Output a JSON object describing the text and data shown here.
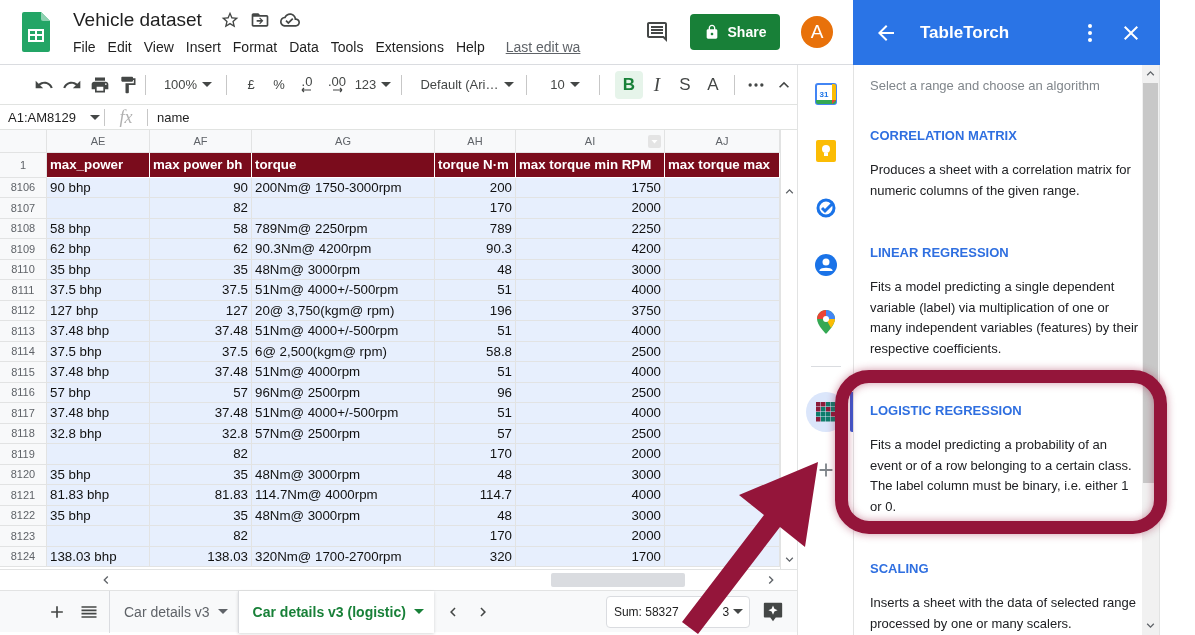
{
  "document": {
    "title": "Vehicle dataset",
    "last_edit": "Last edit wa"
  },
  "menu": [
    "File",
    "Edit",
    "View",
    "Insert",
    "Format",
    "Data",
    "Tools",
    "Extensions",
    "Help"
  ],
  "share_button": "Share",
  "avatar": "A",
  "toolbar": {
    "zoom": "100%",
    "currency": "£",
    "percent": "%",
    "decrease_decimals": ".0",
    "increase_decimals": ".00",
    "number_format": "123",
    "font": "Default (Ari…",
    "font_size": "10",
    "bold": {
      "label": "B",
      "on": true
    },
    "italic": "I",
    "strikethrough": "S",
    "text_color": "A"
  },
  "formula_bar": {
    "name_box": "A1:AM8129",
    "fx": "fx",
    "content": "name"
  },
  "sheet": {
    "selected_range": true,
    "columns": [
      {
        "letter": "AE",
        "kind": "text",
        "filter": false
      },
      {
        "letter": "AF",
        "kind": "number",
        "filter": false
      },
      {
        "letter": "AG",
        "kind": "text",
        "filter": false
      },
      {
        "letter": "AH",
        "kind": "number",
        "filter": false
      },
      {
        "letter": "AI",
        "kind": "number",
        "filter": true
      },
      {
        "letter": "AJ",
        "kind": "number",
        "filter": false
      }
    ],
    "header_row": {
      "number": "1",
      "cells": [
        "max_power",
        "max power bh",
        "torque",
        "torque N·m",
        "max torque min RPM",
        "max torque max"
      ]
    },
    "rows": [
      {
        "number": "8106",
        "cells": [
          "90 bhp",
          "90",
          "200Nm@ 1750-3000rpm",
          "200",
          "1750",
          null
        ]
      },
      {
        "number": "8107",
        "cells": [
          null,
          "82",
          null,
          "170",
          "2000",
          null
        ]
      },
      {
        "number": "8108",
        "cells": [
          "58 bhp",
          "58",
          "789Nm@ 2250rpm",
          "789",
          "2250",
          null
        ]
      },
      {
        "number": "8109",
        "cells": [
          "62 bhp",
          "62",
          "90.3Nm@ 4200rpm",
          "90.3",
          "4200",
          null
        ]
      },
      {
        "number": "8110",
        "cells": [
          "35 bhp",
          "35",
          "48Nm@ 3000rpm",
          "48",
          "3000",
          null
        ]
      },
      {
        "number": "8111",
        "cells": [
          "37.5 bhp",
          "37.5",
          "51Nm@ 4000+/-500rpm",
          "51",
          "4000",
          null
        ]
      },
      {
        "number": "8112",
        "cells": [
          "127 bhp",
          "127",
          "20@ 3,750(kgm@ rpm)",
          "196",
          "3750",
          null
        ]
      },
      {
        "number": "8113",
        "cells": [
          "37.48 bhp",
          "37.48",
          "51Nm@ 4000+/-500rpm",
          "51",
          "4000",
          null
        ]
      },
      {
        "number": "8114",
        "cells": [
          "37.5 bhp",
          "37.5",
          "6@ 2,500(kgm@ rpm)",
          "58.8",
          "2500",
          null
        ]
      },
      {
        "number": "8115",
        "cells": [
          "37.48 bhp",
          "37.48",
          "51Nm@ 4000rpm",
          "51",
          "4000",
          null
        ]
      },
      {
        "number": "8116",
        "cells": [
          "57 bhp",
          "57",
          "96Nm@ 2500rpm",
          "96",
          "2500",
          null
        ]
      },
      {
        "number": "8117",
        "cells": [
          "37.48 bhp",
          "37.48",
          "51Nm@ 4000+/-500rpm",
          "51",
          "4000",
          null
        ]
      },
      {
        "number": "8118",
        "cells": [
          "32.8 bhp",
          "32.8",
          "57Nm@ 2500rpm",
          "57",
          "2500",
          null
        ]
      },
      {
        "number": "8119",
        "cells": [
          null,
          "82",
          null,
          "170",
          "2000",
          null
        ]
      },
      {
        "number": "8120",
        "cells": [
          "35 bhp",
          "35",
          "48Nm@ 3000rpm",
          "48",
          "3000",
          null
        ]
      },
      {
        "number": "8121",
        "cells": [
          "81.83 bhp",
          "81.83",
          "114.7Nm@ 4000rpm",
          "114.7",
          "4000",
          null
        ]
      },
      {
        "number": "8122",
        "cells": [
          "35 bhp",
          "35",
          "48Nm@ 3000rpm",
          "48",
          "3000",
          null
        ]
      },
      {
        "number": "8123",
        "cells": [
          null,
          "82",
          null,
          "170",
          "2000",
          null
        ]
      },
      {
        "number": "8124",
        "cells": [
          "138.03 bhp",
          "138.03",
          "320Nm@ 1700-2700rpm",
          "320",
          "1700",
          null
        ]
      }
    ]
  },
  "sheet_tabs": [
    {
      "label": "Car details v3",
      "selected": false
    },
    {
      "label": "Car details v3 (logistic)",
      "selected": true
    }
  ],
  "sum_box": {
    "text_before_arrow": "Sum: 58327",
    "text_after_arrow": "3"
  },
  "side_apps": [
    {
      "kind": "calendar",
      "label": "31",
      "selected": false
    },
    {
      "kind": "keep",
      "selected": false
    },
    {
      "kind": "tasks",
      "selected": false
    },
    {
      "kind": "contacts",
      "selected": false
    },
    {
      "kind": "maps",
      "selected": false
    },
    {
      "kind": "addon",
      "selected": true
    },
    {
      "kind": "add",
      "selected": false
    }
  ],
  "panel": {
    "title": "TableTorch",
    "intro": "Select a range and choose an algorithm",
    "algorithms": [
      {
        "name": "CORRELATION MATRIX",
        "description": "Produces a sheet with a correlation matrix for numeric columns of the given range.",
        "highlighted": false
      },
      {
        "name": "LINEAR REGRESSION",
        "description": "Fits a model predicting a single dependent variable (label) via multiplication of one or many independent variables (features) by their respective coefficients.",
        "highlighted": false
      },
      {
        "name": "LOGISTIC REGRESSION",
        "description": "Fits a model predicting a probability of an event or of a row belonging to a certain class. The label column must be binary, i.e. either 1 or 0.",
        "highlighted": true
      },
      {
        "name": "SCALING",
        "description": "Inserts a sheet with the data of selected range processed by one or many scalers.",
        "highlighted": false
      }
    ]
  },
  "pointer_arrow": true
}
